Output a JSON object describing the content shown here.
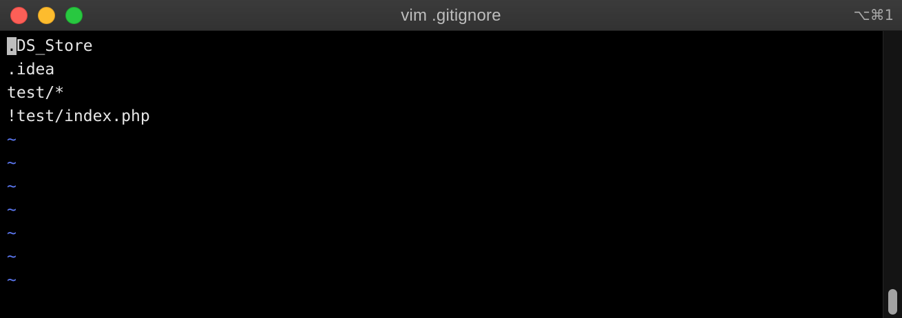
{
  "window": {
    "title": "vim .gitignore",
    "shortcut": "⌥⌘1"
  },
  "editor": {
    "lines": [
      {
        "cursor_char": ".",
        "rest": "DS_Store"
      },
      {
        "text": ".idea"
      },
      {
        "text": "test/*"
      },
      {
        "text": "!test/index.php"
      }
    ],
    "tildes": [
      "~",
      "~",
      "~",
      "~",
      "~",
      "~",
      "~"
    ]
  },
  "colors": {
    "text": "#e6e6e6",
    "tilde": "#5c78f2",
    "cursor": "#bfbfbf",
    "background": "#000000"
  }
}
